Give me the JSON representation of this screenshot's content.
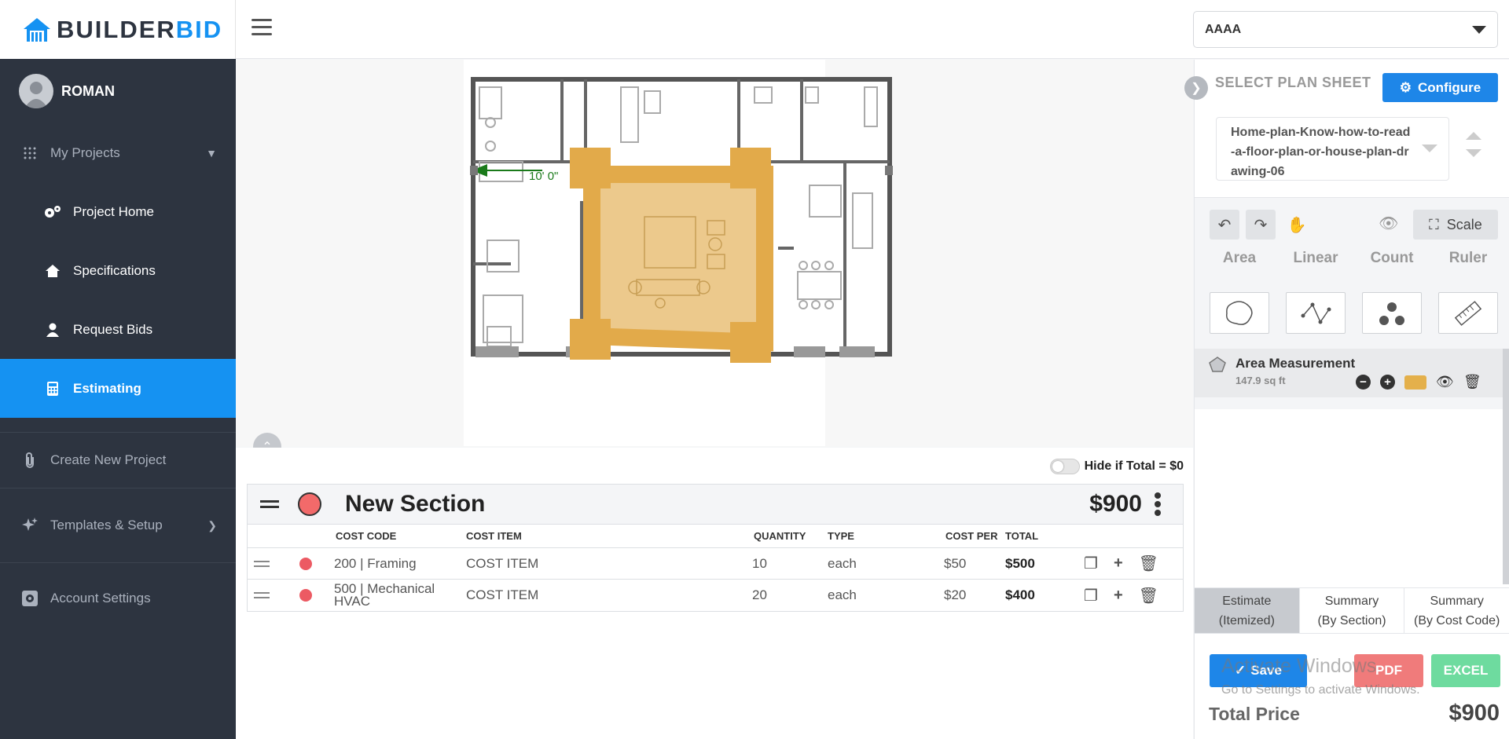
{
  "brand": {
    "part1": "BUILDER",
    "part2": "BID"
  },
  "user": {
    "name": "ROMAN"
  },
  "nav": {
    "my_projects": "My Projects",
    "project_home": "Project Home",
    "specifications": "Specifications",
    "request_bids": "Request Bids",
    "estimating": "Estimating",
    "create_new_project": "Create New Project",
    "templates_setup": "Templates & Setup",
    "account_settings": "Account Settings"
  },
  "header": {
    "project_select": "AAAA"
  },
  "plan": {
    "dimension_label": "10' 0\""
  },
  "estimate": {
    "hide_toggle_label": "Hide if Total = $0",
    "section_title": "New Section",
    "section_total": "$900",
    "columns": [
      "COST CODE",
      "COST ITEM",
      "QUANTITY",
      "TYPE",
      "COST PER",
      "TOTAL"
    ],
    "rows": [
      {
        "code": "200 | Framing",
        "item": "COST ITEM",
        "qty": "10",
        "type": "each",
        "cost_per": "$50",
        "total": "$500"
      },
      {
        "code": "500 | Mechanical HVAC",
        "item": "COST ITEM",
        "qty": "20",
        "type": "each",
        "cost_per": "$20",
        "total": "$400"
      }
    ]
  },
  "panel": {
    "select_plan_sheet": "SELECT PLAN SHEET",
    "configure": "Configure",
    "sheet_name": "Home-plan-Know-how-to-read-a-floor-plan-or-house-plan-drawing-06",
    "scale": "Scale",
    "types": [
      "Area",
      "Linear",
      "Count",
      "Ruler"
    ],
    "measurement_title": "Area Measurement",
    "measurement_value": "147.9 sq ft",
    "measurement_color": "#e4b04b",
    "tabs": [
      {
        "line1": "Estimate",
        "line2": "(Itemized)"
      },
      {
        "line1": "Summary",
        "line2": "(By Section)"
      },
      {
        "line1": "Summary",
        "line2": "(By Cost Code)"
      }
    ],
    "save": "Save",
    "pdf": "PDF",
    "excel": "EXCEL",
    "watermark_title": "Activate Windows",
    "watermark_sub": "Go to Settings to activate Windows.",
    "total_label": "Total Price",
    "total_value": "$900"
  }
}
